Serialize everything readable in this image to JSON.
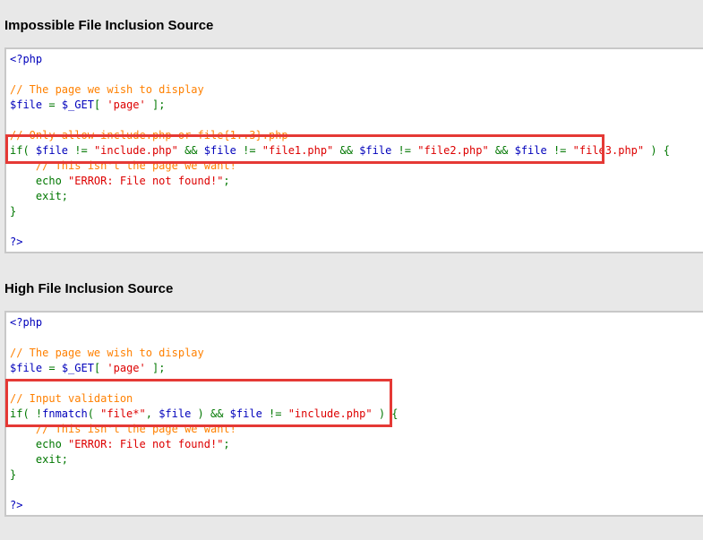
{
  "sections": [
    {
      "title": "Impossible File Inclusion Source",
      "lines": [
        [
          [
            "default",
            "<?php"
          ]
        ],
        [],
        [
          [
            "comment",
            "// The page we wish to display"
          ]
        ],
        [
          [
            "default",
            "$file"
          ],
          [
            "keyword",
            " = "
          ],
          [
            "default",
            "$_GET"
          ],
          [
            "keyword",
            "[ "
          ],
          [
            "string",
            "'page'"
          ],
          [
            "keyword",
            " ];"
          ]
        ],
        [],
        [
          [
            "comment",
            "// Only allow include.php or file{1..3}.php"
          ]
        ],
        [
          [
            "keyword",
            "if( "
          ],
          [
            "default",
            "$file"
          ],
          [
            "keyword",
            " != "
          ],
          [
            "string",
            "\"include.php\""
          ],
          [
            "keyword",
            " && "
          ],
          [
            "default",
            "$file"
          ],
          [
            "keyword",
            " != "
          ],
          [
            "string",
            "\"file1.php\""
          ],
          [
            "keyword",
            " && "
          ],
          [
            "default",
            "$file"
          ],
          [
            "keyword",
            " != "
          ],
          [
            "string",
            "\"file2.php\""
          ],
          [
            "keyword",
            " && "
          ],
          [
            "default",
            "$file"
          ],
          [
            "keyword",
            " != "
          ],
          [
            "string",
            "\"file3.php\""
          ],
          [
            "keyword",
            " ) {"
          ]
        ],
        [
          [
            "comment",
            "    // This isn't the page we want!"
          ]
        ],
        [
          [
            "keyword",
            "    echo "
          ],
          [
            "string",
            "\"ERROR: File not found!\""
          ],
          [
            "keyword",
            ";"
          ]
        ],
        [
          [
            "keyword",
            "    exit;"
          ]
        ],
        [
          [
            "keyword",
            "}"
          ]
        ],
        [],
        [
          [
            "default",
            "?>"
          ]
        ]
      ]
    },
    {
      "title": "High File Inclusion Source",
      "lines": [
        [
          [
            "default",
            "<?php"
          ]
        ],
        [],
        [
          [
            "comment",
            "// The page we wish to display"
          ]
        ],
        [
          [
            "default",
            "$file"
          ],
          [
            "keyword",
            " = "
          ],
          [
            "default",
            "$_GET"
          ],
          [
            "keyword",
            "[ "
          ],
          [
            "string",
            "'page'"
          ],
          [
            "keyword",
            " ];"
          ]
        ],
        [],
        [
          [
            "comment",
            "// Input validation"
          ]
        ],
        [
          [
            "keyword",
            "if( !"
          ],
          [
            "default",
            "fnmatch"
          ],
          [
            "keyword",
            "( "
          ],
          [
            "string",
            "\"file*\""
          ],
          [
            "keyword",
            ", "
          ],
          [
            "default",
            "$file"
          ],
          [
            "keyword",
            " ) && "
          ],
          [
            "default",
            "$file"
          ],
          [
            "keyword",
            " != "
          ],
          [
            "string",
            "\"include.php\""
          ],
          [
            "keyword",
            " ) {"
          ]
        ],
        [
          [
            "comment",
            "    // This isn't the page we want!"
          ]
        ],
        [
          [
            "keyword",
            "    echo "
          ],
          [
            "string",
            "\"ERROR: File not found!\""
          ],
          [
            "keyword",
            ";"
          ]
        ],
        [
          [
            "keyword",
            "    exit;"
          ]
        ],
        [
          [
            "keyword",
            "}"
          ]
        ],
        [],
        [
          [
            "default",
            "?>"
          ]
        ]
      ]
    }
  ],
  "colors": {
    "default": "#0000bb",
    "keyword": "#007700",
    "string": "#dd0000",
    "comment": "#ff8000",
    "highlight": "#e53935"
  }
}
